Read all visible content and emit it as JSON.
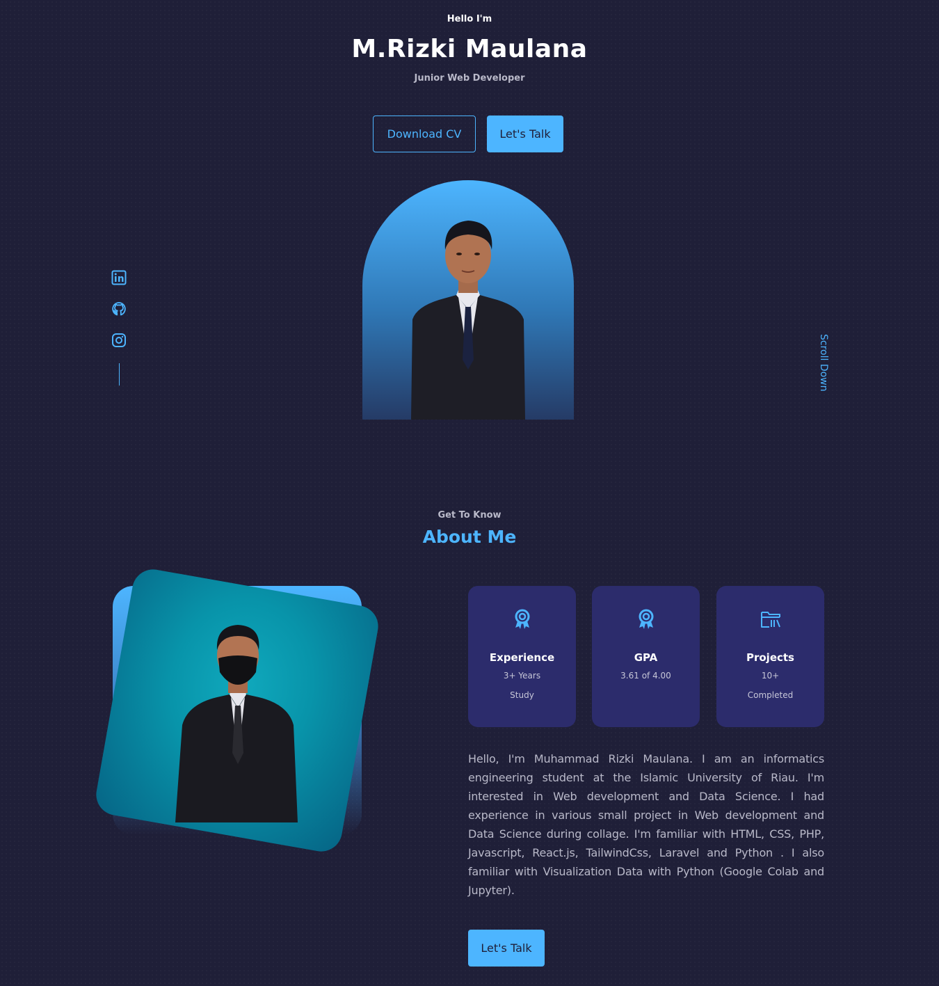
{
  "header": {
    "greeting": "Hello I'm",
    "name": "M.Rizki Maulana",
    "role": "Junior Web Developer"
  },
  "hero_buttons": {
    "download_cv": "Download CV",
    "lets_talk": "Let's Talk"
  },
  "socials": [
    {
      "icon": "linkedin-icon"
    },
    {
      "icon": "github-icon"
    },
    {
      "icon": "instagram-icon"
    }
  ],
  "scroll_down": "Scroll Down",
  "about": {
    "subtitle": "Get To Know",
    "title": "About Me",
    "cards": [
      {
        "icon": "award-icon",
        "title": "Experience",
        "line1": "3+ Years",
        "line2": "Study"
      },
      {
        "icon": "award-icon",
        "title": "GPA",
        "line1": "3.61 of 4.00",
        "line2": ""
      },
      {
        "icon": "folder-icon",
        "title": "Projects",
        "line1": "10+",
        "line2": "Completed"
      }
    ],
    "description": "Hello, I'm Muhammad Rizki Maulana. I am an informatics engineering student at the Islamic University of Riau. I'm interested in Web development and Data Science. I had experience in various small project in Web development and Data Science during collage. I'm familiar with HTML, CSS, PHP, Javascript, React.js, TailwindCss, Laravel and Python . I also familiar with Visualization Data with Python (Google Colab and Jupyter).",
    "cta": "Let's Talk"
  },
  "colors": {
    "background": "#1f1f38",
    "accent": "#4db5ff",
    "card": "#2c2c6c",
    "muted_text": "#b9b9c9"
  }
}
